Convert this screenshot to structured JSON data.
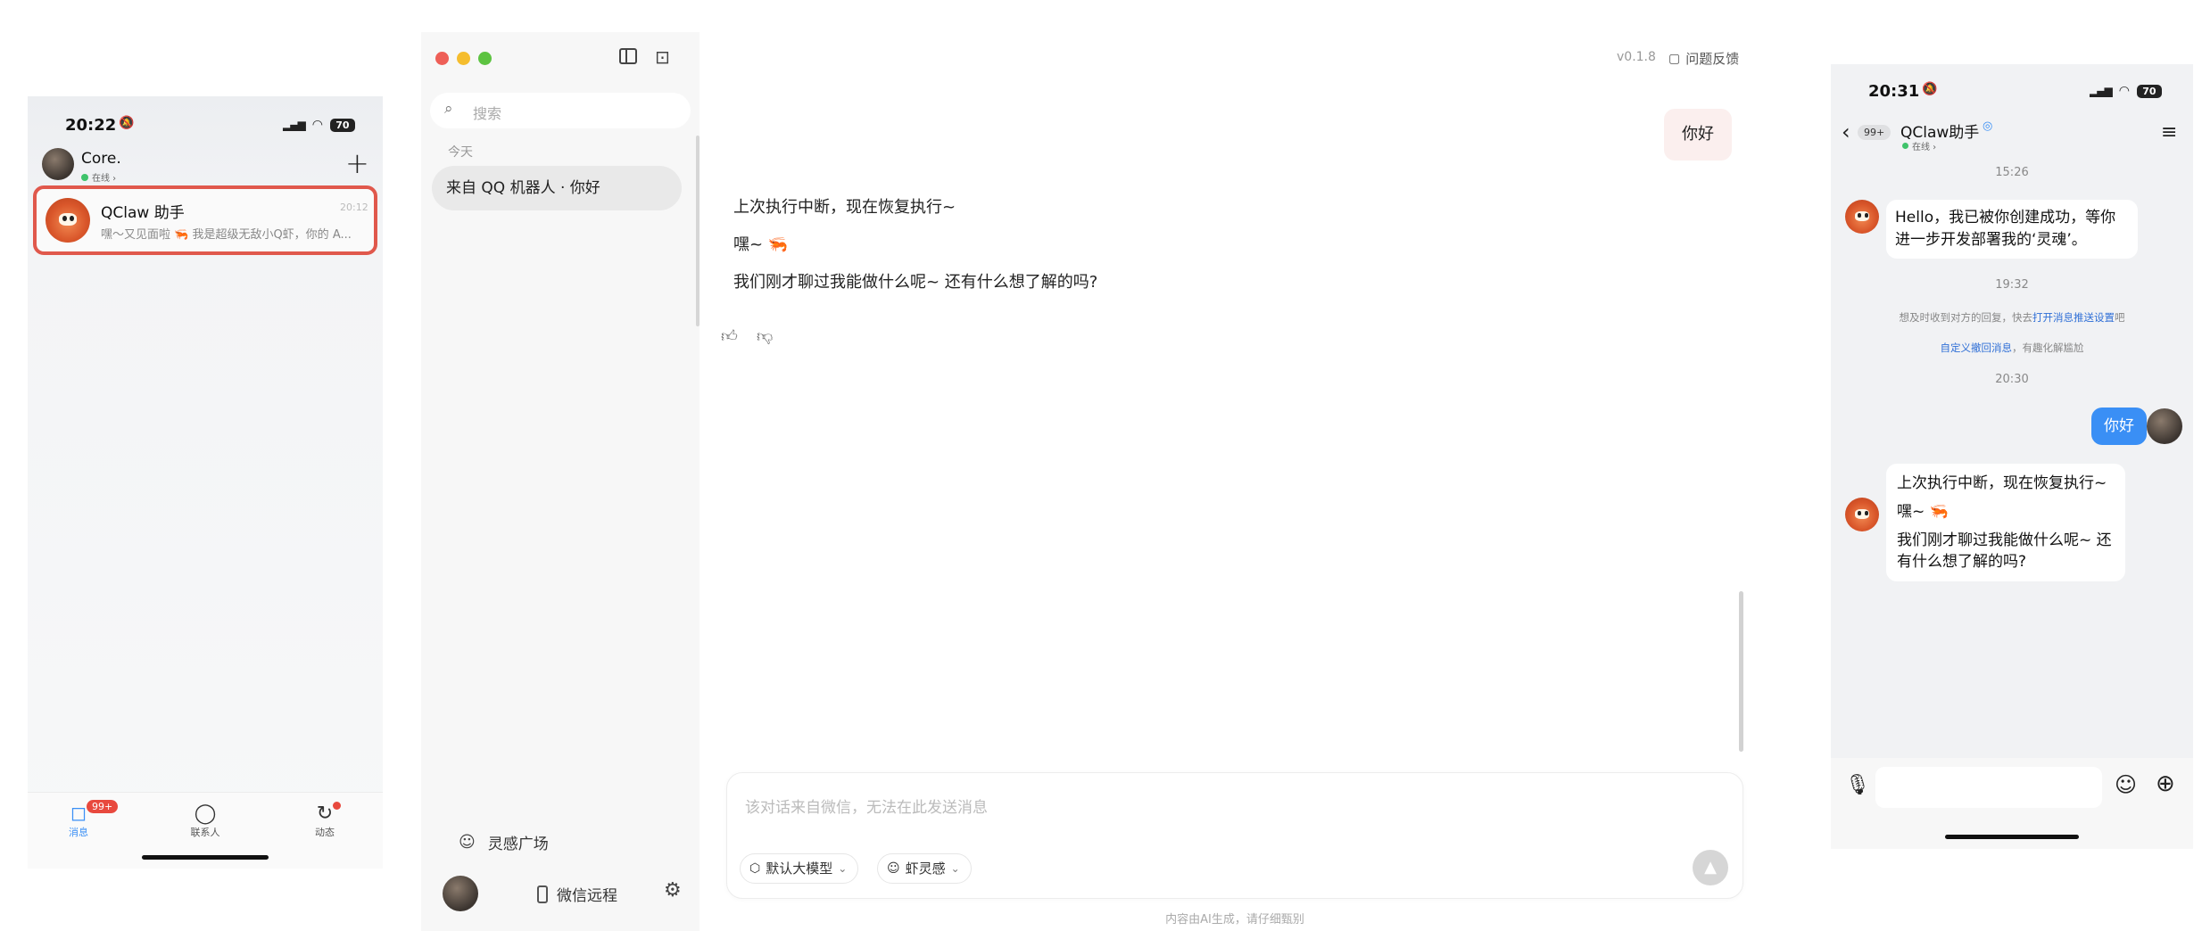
{
  "left_phone": {
    "status_time": "20:22",
    "battery": "70",
    "profile_name": "Core.",
    "profile_status": "在线 ›",
    "chat": {
      "title": "QClaw 助手",
      "time": "20:12",
      "preview": "嘿～又见面啦 🦐 我是超级无敌小Q虾，你的 A..."
    },
    "tabs": [
      {
        "label": "消息",
        "badge": "99+"
      },
      {
        "label": "联系人"
      },
      {
        "label": "动态"
      }
    ]
  },
  "desktop": {
    "version": "v0.1.8",
    "feedback_label": "问题反馈",
    "search_placeholder": "搜索",
    "section_today": "今天",
    "session_title": "来自 QQ 机器人 · 你好",
    "inspiration_label": "灵感广场",
    "wechat_remote_label": "微信远程",
    "user_message": "你好",
    "assistant_lines": [
      "上次执行中断，现在恢复执行~",
      "嘿~ 🦐",
      "我们刚才聊过我能做什么呢~ 还有什么想了解的吗?"
    ],
    "input_placeholder": "该对话来自微信，无法在此发送消息",
    "model_chip": "默认大模型",
    "inspire_chip": "虾灵感",
    "footer_note": "内容由AI生成，请仔细甄别",
    "accent": "#3a8ff5"
  },
  "right_phone": {
    "status_time": "20:31",
    "battery": "70",
    "back_badge": "99+",
    "title": "QClaw助手",
    "subtitle": "在线 ›",
    "ts1": "15:26",
    "msg1": "Hello，我已被你创建成功，等你进一步开发部署我的‘灵魂’。",
    "ts2": "19:32",
    "notice1_prefix": "想及时收到对方的回复，快去",
    "notice1_link": "打开消息推送设置",
    "notice1_suffix": "吧",
    "notice2_link": "自定义撤回消息",
    "notice2_suffix": "，有趣化解尴尬",
    "ts3": "20:30",
    "msg_out": "你好",
    "msg2_lines": [
      "上次执行中断，现在恢复执行~",
      "嘿~ 🦐",
      "我们刚才聊过我能做什么呢~ 还有什么想了解的吗?"
    ]
  }
}
